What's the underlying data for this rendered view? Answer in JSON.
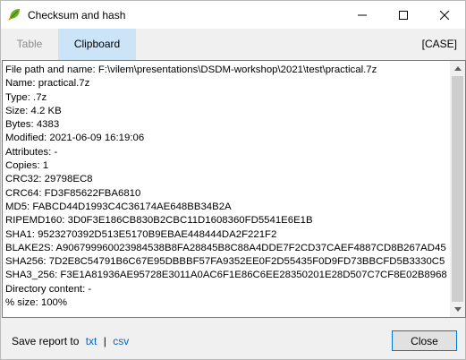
{
  "window": {
    "title": "Checksum and hash",
    "controls": {
      "minimize": "minimize",
      "maximize": "maximize",
      "close": "close"
    }
  },
  "tabs": [
    {
      "label": "Table",
      "active": false
    },
    {
      "label": "Clipboard",
      "active": true
    }
  ],
  "case_label": "[CASE]",
  "content": {
    "lines": [
      "File path and name: F:\\vilem\\presentations\\DSDM-workshop\\2021\\test\\practical.7z",
      "Name: practical.7z",
      "Type: .7z",
      "Size: 4.2 KB",
      "Bytes: 4383",
      "Modified: 2021-06-09 16:19:06",
      "Attributes: -",
      "Copies: 1",
      "CRC32: 29798EC8",
      "CRC64: FD3F85622FBA6810",
      "MD5: FABCD44D1993C4C36174AE648BB34B2A",
      "RIPEMD160: 3D0F3E186CB830B2CBC11D1608360FD5541E6E1B",
      "SHA1: 9523270392D513E5170B9EBAE448444DA2F221F2",
      "BLAKE2S: A906799960023984538B8FA28845B8C88A4DDE7F2CD37CAEF4887CD8B267AD45",
      "SHA256: 7D2E8C54791B6C67E95DBBBF57FA9352EE0F2D55435F0D9FD73BBCFD5B3330C5",
      "SHA3_256: F3E1A81936AE95728E3011A0AC6F1E86C6EE28350201E28D507C7CF8E02B8968",
      "Directory content: -",
      "% size: 100%"
    ]
  },
  "footer": {
    "save_label": "Save report to",
    "txt_link": "txt",
    "separator": "|",
    "csv_link": "csv",
    "close_button": "Close"
  },
  "colors": {
    "accent": "#0078d7",
    "active_tab": "#cce4f7",
    "link": "#0066cc",
    "icon_green": "#6ab023"
  }
}
